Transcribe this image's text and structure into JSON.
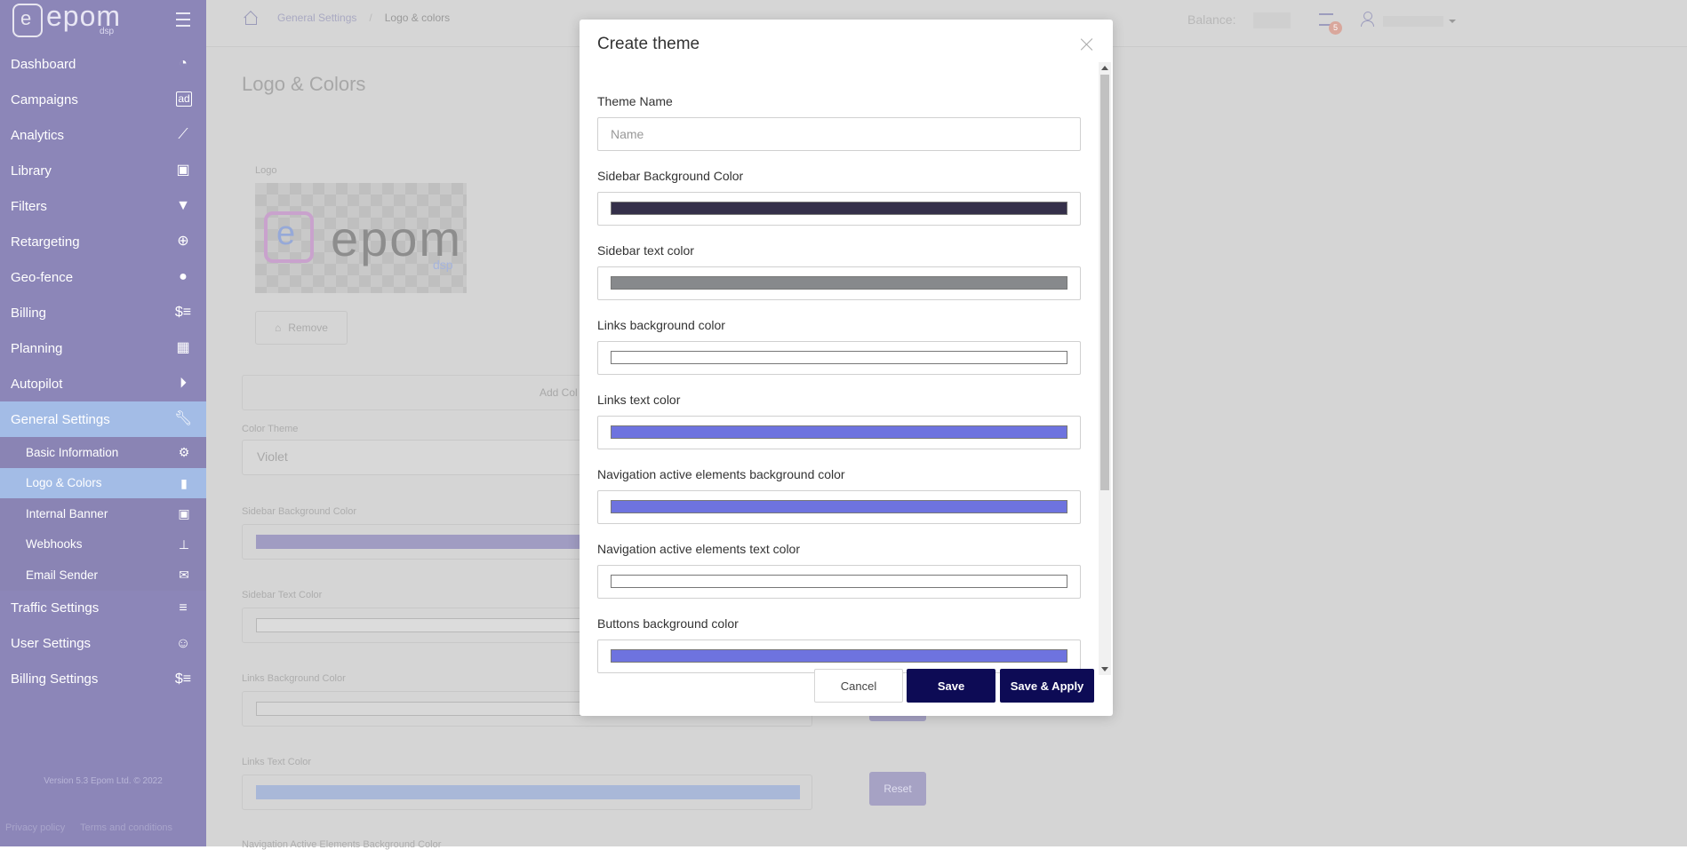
{
  "sidebar": {
    "logo_text": "epom",
    "logo_sub": "dsp",
    "items": [
      {
        "label": "Dashboard",
        "icon": "gauge-icon"
      },
      {
        "label": "Campaigns",
        "icon": "ad-icon"
      },
      {
        "label": "Analytics",
        "icon": "chart-line-icon"
      },
      {
        "label": "Library",
        "icon": "image-icon"
      },
      {
        "label": "Filters",
        "icon": "filter-icon"
      },
      {
        "label": "Retargeting",
        "icon": "crosshair-icon"
      },
      {
        "label": "Geo-fence",
        "icon": "map-pin-icon"
      },
      {
        "label": "Billing",
        "icon": "billing-icon"
      },
      {
        "label": "Planning",
        "icon": "calendar-icon"
      },
      {
        "label": "Autopilot",
        "icon": "play-circle-icon"
      },
      {
        "label": "General Settings",
        "icon": "wrench-icon"
      }
    ],
    "sub_items": [
      {
        "label": "Basic Information",
        "icon": "gear-icon"
      },
      {
        "label": "Logo & Colors",
        "icon": "brush-icon"
      },
      {
        "label": "Internal Banner",
        "icon": "image-icon"
      },
      {
        "label": "Webhooks",
        "icon": "sitemap-icon"
      },
      {
        "label": "Email Sender",
        "icon": "envelope-icon"
      }
    ],
    "bottom_items": [
      {
        "label": "Traffic Settings",
        "icon": "list-icon"
      },
      {
        "label": "User Settings",
        "icon": "user-gear-icon"
      },
      {
        "label": "Billing Settings",
        "icon": "billing-icon"
      }
    ],
    "version": "Version 5.3 Epom Ltd. © 2022",
    "footer_links": [
      "Privacy policy",
      "Terms and conditions"
    ]
  },
  "topbar": {
    "breadcrumb": [
      "General Settings",
      "Logo & colors"
    ],
    "balance_label": "Balance:",
    "notification_count": "5"
  },
  "page": {
    "title": "Logo & Colors",
    "logo_label": "Logo",
    "remove_label": "Remove",
    "add_label": "Add Col",
    "color_theme_label": "Color Theme",
    "color_theme_value": "Violet",
    "sidebar_bg_label": "Sidebar Background Color",
    "sidebar_text_label": "Sidebar Text Color",
    "links_bg_label": "Links Background Color",
    "links_text_label": "Links Text Color",
    "nav_active_bg_label": "Navigation Active Elements Background Color",
    "reset_label": "Reset"
  },
  "modal": {
    "title": "Create theme",
    "theme_name_label": "Theme Name",
    "theme_name_placeholder": "Name",
    "fields": [
      {
        "label": "Sidebar Background Color",
        "color": "#35304a"
      },
      {
        "label": "Sidebar text color",
        "color": "#87898c"
      },
      {
        "label": "Links background color",
        "color": "#ffffff"
      },
      {
        "label": "Links text color",
        "color": "#6e73df"
      },
      {
        "label": "Navigation active elements background color",
        "color": "#6e73df"
      },
      {
        "label": "Navigation active elements text color",
        "color": "#ffffff"
      },
      {
        "label": "Buttons background color",
        "color": "#6e73df"
      }
    ],
    "cancel_label": "Cancel",
    "save_label": "Save",
    "save_apply_label": "Save & Apply"
  },
  "colors": {
    "primary_button": "#0d0b55",
    "sidebar": "#8c86b8",
    "sidebar_active": "#a3bce6"
  }
}
